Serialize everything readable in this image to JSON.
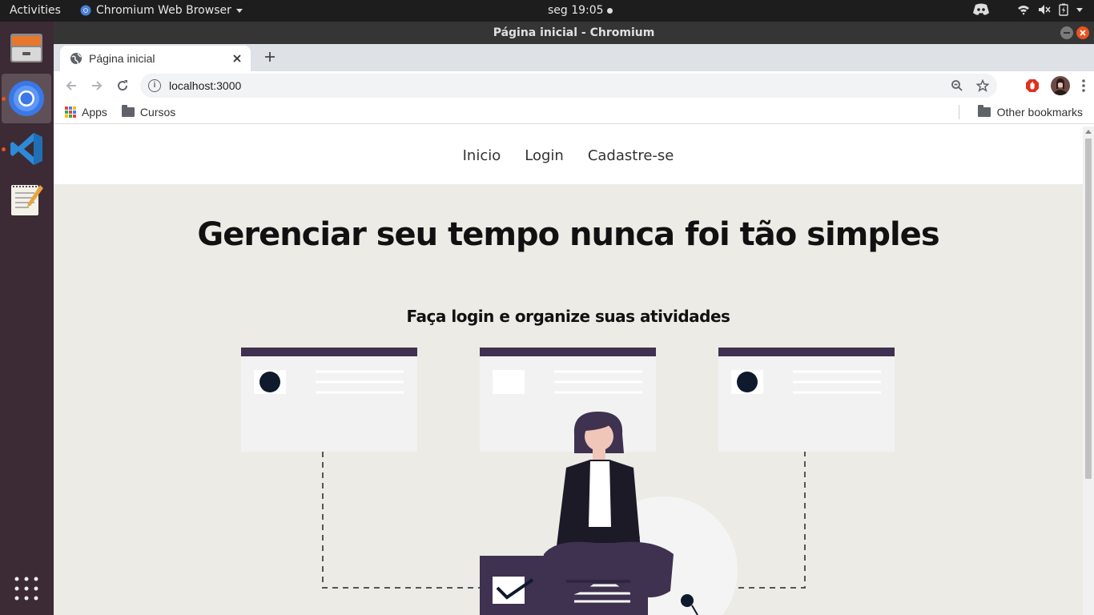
{
  "topbar": {
    "activities": "Activities",
    "app_name": "Chromium Web Browser",
    "clock": "seg 19:05"
  },
  "window": {
    "title": "Página inicial - Chromium"
  },
  "tab": {
    "title": "Página inicial"
  },
  "omnibox": {
    "url": "localhost:3000"
  },
  "bookmarks": {
    "apps": "Apps",
    "cursos": "Cursos",
    "other": "Other bookmarks"
  },
  "site": {
    "nav": [
      "Inicio",
      "Login",
      "Cadastre-se"
    ],
    "title": "Gerenciar seu tempo nunca foi tão simples",
    "subtitle": "Faça login e organize suas atividades"
  },
  "colors": {
    "page_bg": "#ecebe6",
    "card_header": "#3f3150",
    "card_body": "#f2f2f2",
    "dark": "#0f1a2c",
    "accent_orange": "#e95420"
  },
  "icons": {
    "dock": [
      "files-icon",
      "chromium-icon",
      "vscode-icon",
      "text-editor-icon",
      "show-apps-icon"
    ]
  }
}
